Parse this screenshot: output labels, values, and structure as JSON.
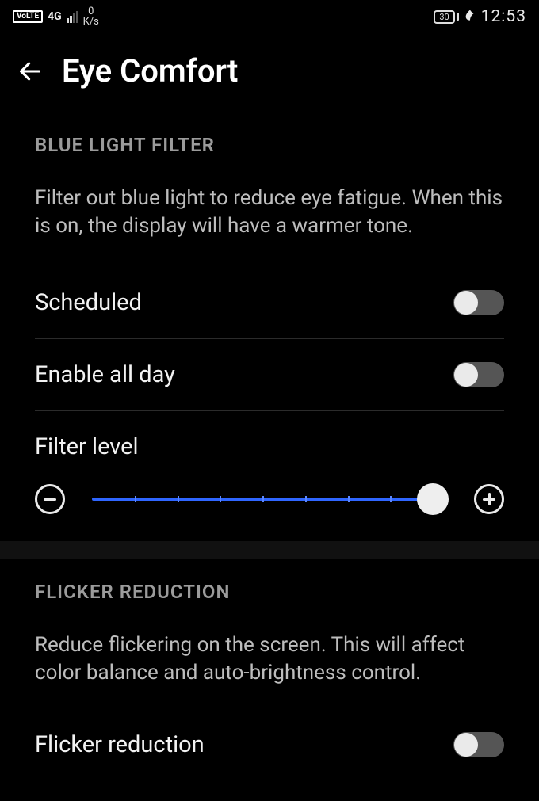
{
  "statusbar": {
    "volte": "VoLTE",
    "network": "4G",
    "speed_value": "0",
    "speed_unit": "K/s",
    "battery_percent": "30",
    "time": "12:53"
  },
  "header": {
    "title": "Eye Comfort"
  },
  "sections": {
    "blue_light": {
      "title": "BLUE LIGHT FILTER",
      "description": "Filter out blue light to reduce eye fatigue. When this is on, the display will have a warmer tone.",
      "scheduled_label": "Scheduled",
      "scheduled_on": false,
      "enable_all_day_label": "Enable all day",
      "enable_all_day_on": false,
      "filter_level_label": "Filter level",
      "filter_level_percent": 96
    },
    "flicker": {
      "title": "FLICKER REDUCTION",
      "description": "Reduce flickering on the screen. This will affect color balance and auto-brightness control.",
      "flicker_reduction_label": "Flicker reduction",
      "flicker_reduction_on": false
    }
  }
}
